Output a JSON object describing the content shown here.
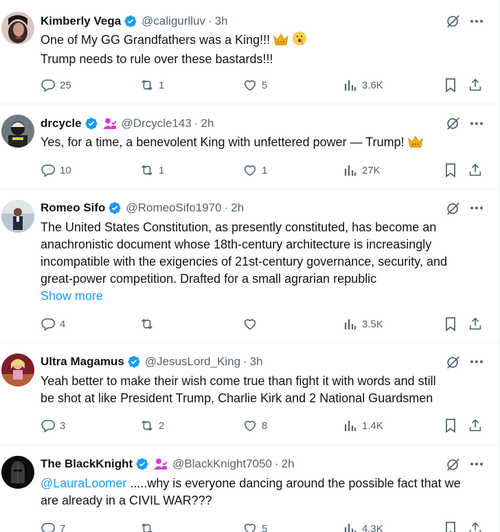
{
  "colors": {
    "accent": "#1d9bf0",
    "muted": "#536471",
    "text": "#0f1419",
    "verified": "#1d9bf0",
    "affiliate": "#d43fce",
    "crown": "#f5b400"
  },
  "tweets": [
    {
      "name": "Kimberly Vega",
      "verified": true,
      "affiliate": false,
      "handle": "@caligurlluv",
      "time": "3h",
      "lines": [
        "One of My GG Grandfathers was a King!!!",
        "Trump needs to rule over these bastards!!!"
      ],
      "emoji": [
        "crown",
        "shushing-face"
      ],
      "stats": {
        "replies": "25",
        "retweets": "1",
        "likes": "5",
        "views": "3.6K"
      }
    },
    {
      "name": "drcycle",
      "verified": true,
      "affiliate": true,
      "handle": "@Drcycle143",
      "time": "2h",
      "lines": [
        "Yes, for a time, a benevolent King with unfettered power — Trump!"
      ],
      "emoji": [
        "crown"
      ],
      "stats": {
        "replies": "10",
        "retweets": "1",
        "likes": "1",
        "views": "27K"
      }
    },
    {
      "name": "Romeo Sifo",
      "verified": true,
      "affiliate": false,
      "handle": "@RomeoSifo1970",
      "time": "2h",
      "lines": [
        "The United States Constitution, as presently constituted, has become an",
        "anachronistic document whose 18th-century architecture is increasingly",
        "incompatible with the exigencies of 21st-century governance, security, and",
        "great-power competition. Drafted for a small agrarian republic"
      ],
      "show_more": "Show more",
      "stats": {
        "replies": "4",
        "retweets": "",
        "likes": "",
        "views": "3.5K"
      }
    },
    {
      "name": "Ultra Magamus",
      "verified": true,
      "affiliate": false,
      "handle": "@JesusLord_King",
      "time": "3h",
      "lines": [
        "Yeah better to make their wish come true than fight it with words and still",
        "be shot at like President Trump, Charlie Kirk and 2 National Guardsmen"
      ],
      "stats": {
        "replies": "3",
        "retweets": "2",
        "likes": "8",
        "views": "1.4K"
      }
    },
    {
      "name": "The BlackKnight",
      "verified": true,
      "affiliate": true,
      "handle": "@BlackKnight7050",
      "time": "2h",
      "mention": "@LauraLoomer",
      "lines": [
        " .....why is everyone dancing around the possible fact that we",
        "are already in a CIVIL WAR???"
      ],
      "stats": {
        "replies": "7",
        "retweets": "",
        "likes": "5",
        "views": "4.3K"
      }
    }
  ],
  "icons": {
    "grok": "grok-icon",
    "more": "more-icon",
    "reply": "reply-icon",
    "retweet": "retweet-icon",
    "like": "like-icon",
    "views": "views-icon",
    "bookmark": "bookmark-icon",
    "share": "share-icon"
  }
}
